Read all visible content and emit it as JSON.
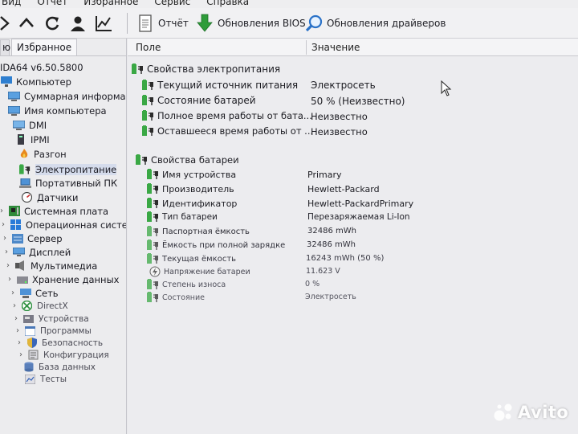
{
  "menu": [
    "Вид",
    "Отчет",
    "Избранное",
    "Сервис",
    "Справка"
  ],
  "toolbar": {
    "icons": [
      "nav-back-icon",
      "nav-up-icon",
      "refresh-icon",
      "user-icon",
      "chart-icon"
    ],
    "report_label": "Отчёт",
    "bios_label": "Обновления BIOS",
    "drivers_label": "Обновления драйверов"
  },
  "left_panel": {
    "tab_cut": "ю",
    "tab_label": "Избранное",
    "tree": [
      {
        "label": "IDA64 v6.50.5800",
        "icon": "aida-icon",
        "expander": ""
      },
      {
        "label": "Компьютер",
        "icon": "computer-icon",
        "expander": ""
      },
      {
        "label": "Суммарная информация",
        "icon": "summary-icon",
        "expander": ""
      },
      {
        "label": "Имя компьютера",
        "icon": "computer-name-icon",
        "expander": ""
      },
      {
        "label": "DMI",
        "icon": "dmi-icon",
        "expander": ""
      },
      {
        "label": "IPMI",
        "icon": "ipmi-icon",
        "expander": ""
      },
      {
        "label": "Разгон",
        "icon": "flame-icon",
        "expander": ""
      },
      {
        "label": "Электропитание",
        "icon": "power-plug-icon",
        "expander": ""
      },
      {
        "label": "Портативный ПК",
        "icon": "laptop-icon",
        "expander": ""
      },
      {
        "label": "Датчики",
        "icon": "sensor-gauge-icon",
        "expander": ""
      },
      {
        "label": "Системная плата",
        "icon": "motherboard-icon",
        "expander": "›"
      },
      {
        "label": "Операционная система",
        "icon": "windows-icon",
        "expander": "›"
      },
      {
        "label": "Сервер",
        "icon": "server-icon",
        "expander": "›"
      },
      {
        "label": "Дисплей",
        "icon": "display-icon",
        "expander": "›"
      },
      {
        "label": "Мультимедиа",
        "icon": "multimedia-icon",
        "expander": "›"
      },
      {
        "label": "Хранение данных",
        "icon": "storage-icon",
        "expander": "›"
      },
      {
        "label": "Сеть",
        "icon": "network-icon",
        "expander": "›"
      },
      {
        "label": "DirectX",
        "icon": "directx-icon",
        "expander": "›"
      },
      {
        "label": "Устройства",
        "icon": "devices-icon",
        "expander": "›"
      },
      {
        "label": "Программы",
        "icon": "programs-icon",
        "expander": "›"
      },
      {
        "label": "Безопасность",
        "icon": "security-shield-icon",
        "expander": "›"
      },
      {
        "label": "Конфигурация",
        "icon": "config-icon",
        "expander": "›"
      },
      {
        "label": "База данных",
        "icon": "database-icon",
        "expander": ""
      },
      {
        "label": "Тесты",
        "icon": "benchmark-icon",
        "expander": ""
      }
    ]
  },
  "columns": {
    "field": "Поле",
    "value": "Значение"
  },
  "sections": [
    {
      "title": "Свойства электропитания",
      "rows": [
        {
          "field": "Текущий источник питания",
          "value": "Электросеть"
        },
        {
          "field": "Состояние батарей",
          "value": "50 % (Неизвестно)"
        },
        {
          "field": "Полное время работы от бата...",
          "value": "Неизвестно"
        },
        {
          "field": "Оставшееся время работы от ...",
          "value": "Неизвестно"
        }
      ]
    },
    {
      "title": "Свойства батареи",
      "rows": [
        {
          "field": "Имя устройства",
          "value": "Primary"
        },
        {
          "field": "Производитель",
          "value": "Hewlett-Packard"
        },
        {
          "field": "Идентификатор",
          "value": "Hewlett-PackardPrimary"
        },
        {
          "field": "Тип батареи",
          "value": "Перезаряжаемая Li-Ion"
        },
        {
          "field": "Паспортная ёмкость",
          "value": "32486 mWh"
        },
        {
          "field": "Ёмкость при полной зарядке",
          "value": "32486 mWh"
        },
        {
          "field": "Текущая ёмкость",
          "value": "16243 mWh  (50 %)"
        },
        {
          "field": "Напряжение батареи",
          "value": "11.623 V"
        },
        {
          "field": "Степень износа",
          "value": "0 %"
        },
        {
          "field": "Состояние",
          "value": "Электросеть"
        }
      ]
    }
  ],
  "watermark": "Avito",
  "colors": {
    "battery_green": "#3aa845",
    "plug_dark": "#2b2b2b",
    "selection": "#d5dcec"
  }
}
